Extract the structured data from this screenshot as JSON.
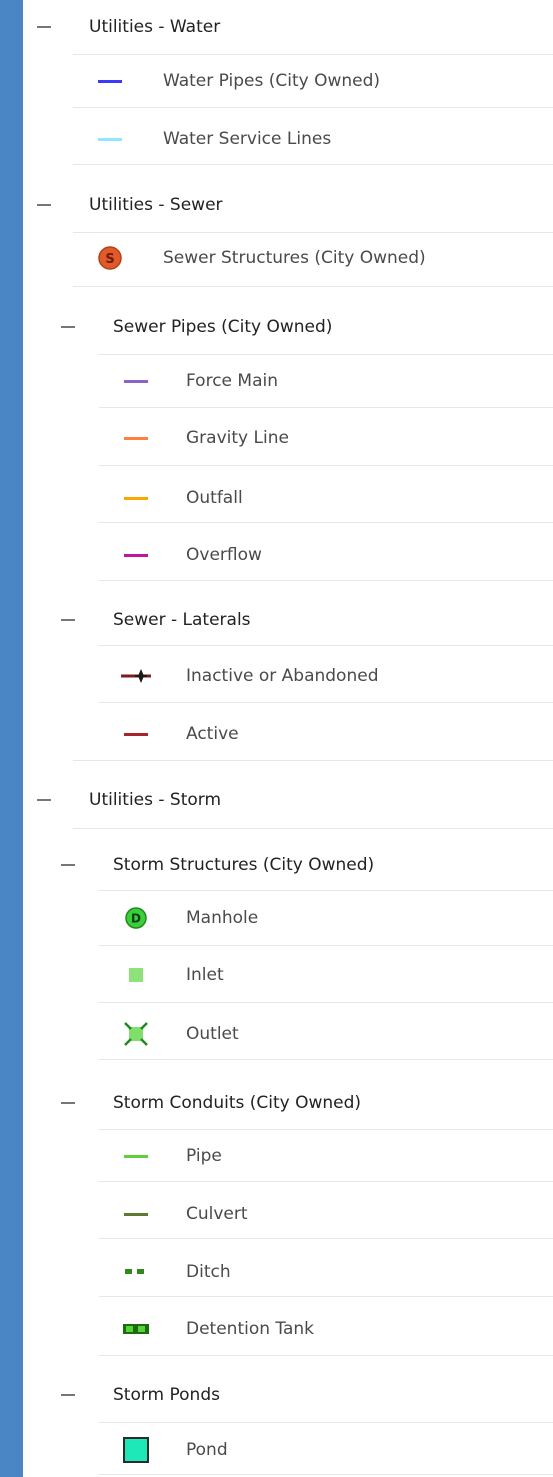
{
  "legend": {
    "water": {
      "title": "Utilities - Water",
      "items": [
        {
          "label": "Water Pipes (City Owned)",
          "color": "#3a3aff"
        },
        {
          "label": "Water Service Lines",
          "color": "#8fe6ff"
        }
      ]
    },
    "sewer": {
      "title": "Utilities - Sewer",
      "structures": {
        "label": "Sewer Structures (City Owned)",
        "symbol": "S",
        "color": "#e05a2b"
      },
      "pipes": {
        "title": "Sewer Pipes (City Owned)",
        "items": [
          {
            "label": "Force Main",
            "color": "#8a63c9"
          },
          {
            "label": "Gravity Line",
            "color": "#ff7f41"
          },
          {
            "label": "Outfall",
            "color": "#ffa500"
          },
          {
            "label": "Overflow",
            "color": "#c0159e"
          }
        ]
      },
      "laterals": {
        "title": "Sewer - Laterals",
        "items": [
          {
            "label": "Inactive or Abandoned",
            "color": "#7a1f1f"
          },
          {
            "label": "Active",
            "color": "#a4262c"
          }
        ]
      }
    },
    "storm": {
      "title": "Utilities - Storm",
      "structures": {
        "title": "Storm Structures (City Owned)",
        "items": [
          {
            "label": "Manhole",
            "symbol": "D",
            "color": "#3ccf3c"
          },
          {
            "label": "Inlet",
            "color": "#8de27a"
          },
          {
            "label": "Outlet",
            "color": "#7ee06a"
          }
        ]
      },
      "conduits": {
        "title": "Storm Conduits (City Owned)",
        "items": [
          {
            "label": "Pipe",
            "color": "#5fcf3a"
          },
          {
            "label": "Culvert",
            "color": "#5e7a2e"
          },
          {
            "label": "Ditch",
            "color": "#2f8a1a"
          },
          {
            "label": "Detention Tank",
            "color": "#2fa51a"
          }
        ]
      },
      "ponds": {
        "title": "Storm Ponds",
        "items": [
          {
            "label": "Pond",
            "color": "#1ee8b8"
          }
        ]
      }
    }
  }
}
